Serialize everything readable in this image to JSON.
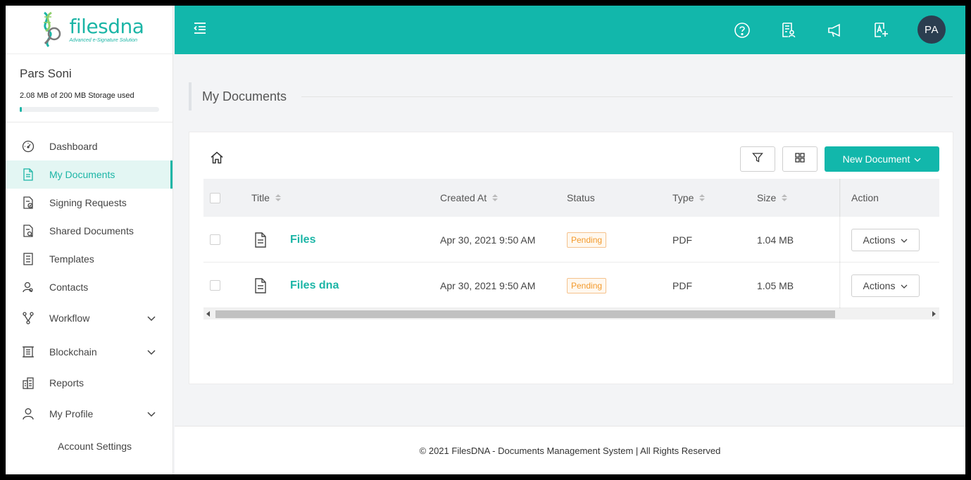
{
  "brand": {
    "logo_text": "filesdna",
    "logo_tagline": "Advanced e-Signature Solution",
    "accent": "#12b7ab"
  },
  "user": {
    "name": "Pars Soni",
    "storage_text": "2.08 MB of 200 MB Storage used",
    "storage_used_fraction": 0.0104,
    "avatar_initials": "PA"
  },
  "sidebar": {
    "items": [
      {
        "label": "Dashboard",
        "icon": "dashboard-gauge-icon"
      },
      {
        "label": "My Documents",
        "icon": "document-icon",
        "active": true
      },
      {
        "label": "Signing Requests",
        "icon": "signing-request-icon"
      },
      {
        "label": "Shared Documents",
        "icon": "shared-document-icon"
      },
      {
        "label": "Templates",
        "icon": "template-icon"
      },
      {
        "label": "Contacts",
        "icon": "contacts-icon"
      },
      {
        "label": "Workflow",
        "icon": "workflow-icon",
        "expandable": true
      },
      {
        "label": "Blockchain",
        "icon": "blockchain-icon",
        "expandable": true
      },
      {
        "label": "Reports",
        "icon": "reports-icon"
      },
      {
        "label": "My Profile",
        "icon": "user-icon",
        "expandable": true,
        "expanded": true
      }
    ],
    "subitems": [
      {
        "label": "Account Settings"
      }
    ]
  },
  "topbar": {
    "icons": [
      "help-circle-icon",
      "document-user-icon",
      "megaphone-icon",
      "signature-add-icon"
    ]
  },
  "page": {
    "title": "My Documents"
  },
  "toolbar": {
    "new_document_label": "New Document"
  },
  "table": {
    "columns": [
      "Title",
      "Created At",
      "Status",
      "Type",
      "Size",
      "Action"
    ],
    "rows": [
      {
        "title": "Files",
        "created_at": "Apr 30, 2021 9:50 AM",
        "status": "Pending",
        "type": "PDF",
        "size": "1.04 MB",
        "action_label": "Actions"
      },
      {
        "title": "Files dna",
        "created_at": "Apr 30, 2021 9:50 AM",
        "status": "Pending",
        "type": "PDF",
        "size": "1.05 MB",
        "action_label": "Actions"
      }
    ]
  },
  "footer": {
    "text": "© 2021 FilesDNA - Documents Management System | All Rights Reserved"
  }
}
